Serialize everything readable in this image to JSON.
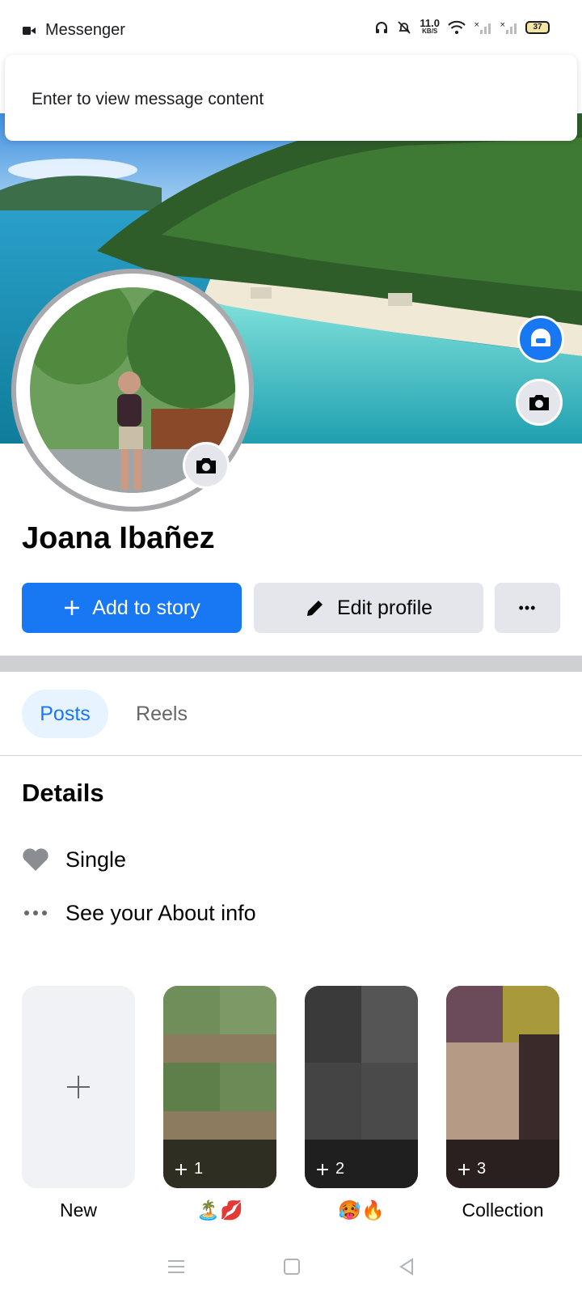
{
  "status_bar": {
    "app_name": "Messenger",
    "net_speed": "11.0",
    "net_unit": "KB/S",
    "battery": "37"
  },
  "notification": {
    "text": "Enter to view message content"
  },
  "profile": {
    "name": "Joana Ibañez"
  },
  "actions": {
    "add_story": "Add to story",
    "edit_profile": "Edit profile",
    "more": "•••"
  },
  "tabs": [
    {
      "label": "Posts",
      "active": true
    },
    {
      "label": "Reels",
      "active": false
    }
  ],
  "details": {
    "title": "Details",
    "items": [
      {
        "icon": "heart-icon",
        "text": "Single"
      },
      {
        "icon": "more-dots-icon",
        "text": "See your About info"
      }
    ]
  },
  "highlights": [
    {
      "label": "New",
      "count": ""
    },
    {
      "label": "🏝️💋",
      "count": "1"
    },
    {
      "label": "🥵🔥",
      "count": "2"
    },
    {
      "label": "Collection",
      "count": "3"
    }
  ],
  "colors": {
    "accent": "#1877f2",
    "button_secondary": "#e4e6eb",
    "tab_active_bg": "#e7f3ff"
  }
}
